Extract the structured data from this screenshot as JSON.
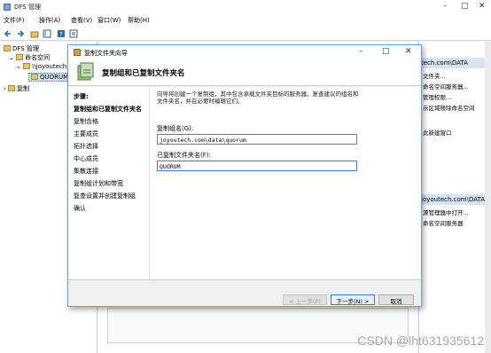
{
  "mmc": {
    "title": "DFS 管理",
    "menu": [
      "文件(F)",
      "操作(A)",
      "查看(V)",
      "窗口(W)",
      "帮助(H)"
    ],
    "tree": [
      {
        "label": "DFS 管理"
      },
      {
        "label": "命名空间"
      },
      {
        "label": "\\\\joyoutech."
      },
      {
        "label": "QUORUM"
      },
      {
        "label": "复制"
      }
    ],
    "actions": {
      "header1": "tech.com\\DATA",
      "items1": [
        "文件夹...",
        "命名空间服务器...",
        "管理权限...",
        "示区域移除命名空间",
        "",
        "此新建窗口"
      ],
      "header2": "joyoutech.com\\DATA",
      "items2": [
        "源管理器中打开...",
        "命名空间服务器"
      ]
    }
  },
  "wizard": {
    "title": "复制文件夹向导",
    "header": "复制组和已复制文件夹名",
    "steps_heading": "步骤:",
    "steps": [
      "复制组和已复制文件夹名",
      "复制合格",
      "主要成员",
      "拓扑选择",
      "中心成员",
      "集散连接",
      "复制组计划和带宽",
      "复查设置并创建复制组",
      "确认"
    ],
    "intro": "向导将创建一个复制组，其中包含承载文件夹目标的服务器。复查建议的组名和文件夹名，并在必要时编辑它们。",
    "group_label": "复制组名(G):",
    "group_value": "joyoutech.com\\data\\quorum",
    "folder_label": "已复制文件夹名(F):",
    "folder_value": "QUORUM",
    "buttons": {
      "prev": "< 上一步(P)",
      "next": "下一步(N) >",
      "cancel": "取消"
    }
  },
  "watermark": "CSDN @lht631935612"
}
